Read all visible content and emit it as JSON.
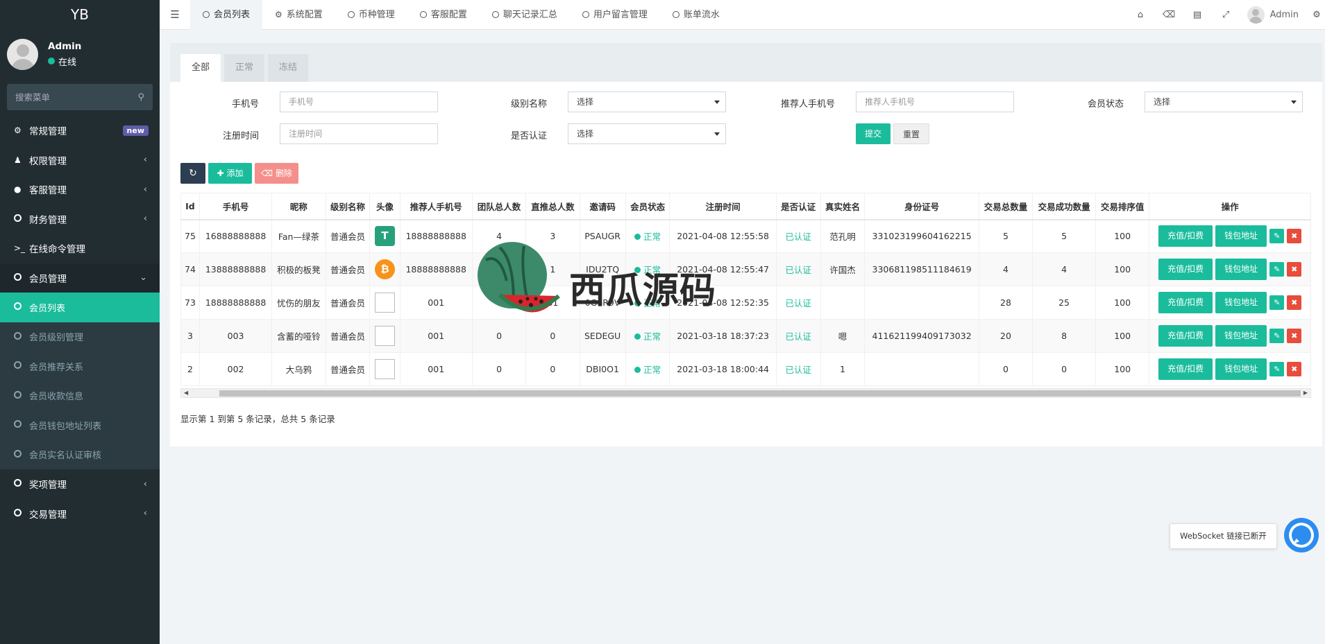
{
  "sidebar": {
    "logo": "YB",
    "user": {
      "name": "Admin",
      "status": "在线"
    },
    "search_placeholder": "搜索菜单",
    "menu": [
      {
        "label": "常规管理",
        "icon": "cogs-icon",
        "badge": "new"
      },
      {
        "label": "权限管理",
        "icon": "users-icon"
      },
      {
        "label": "客服管理",
        "icon": "comment-icon"
      },
      {
        "label": "财务管理",
        "icon": "circle-icon"
      },
      {
        "label": "在线命令管理",
        "icon": "terminal-icon"
      },
      {
        "label": "会员管理",
        "icon": "circle-icon"
      }
    ],
    "submenu": [
      {
        "label": "会员列表"
      },
      {
        "label": "会员级别管理"
      },
      {
        "label": "会员推荐关系"
      },
      {
        "label": "会员收款信息"
      },
      {
        "label": "会员钱包地址列表"
      },
      {
        "label": "会员实名认证审核"
      }
    ],
    "menu_after": [
      {
        "label": "奖项管理"
      },
      {
        "label": "交易管理"
      }
    ]
  },
  "topbar": {
    "tabs": [
      "会员列表",
      "系统配置",
      "币种管理",
      "客服配置",
      "聊天记录汇总",
      "用户留言管理",
      "账单流水"
    ],
    "user_name": "Admin"
  },
  "status_tabs": [
    "全部",
    "正常",
    "冻结"
  ],
  "filters": {
    "phone_label": "手机号",
    "phone_placeholder": "手机号",
    "level_label": "级别名称",
    "level_value": "选择",
    "ref_label": "推荐人手机号",
    "ref_placeholder": "推荐人手机号",
    "status_label": "会员状态",
    "status_value": "选择",
    "regtime_label": "注册时间",
    "regtime_placeholder": "注册时间",
    "verified_label": "是否认证",
    "verified_value": "选择",
    "submit": "提交",
    "reset": "重置"
  },
  "toolbar": {
    "add": "添加",
    "delete": "删除"
  },
  "table": {
    "columns": [
      "Id",
      "手机号",
      "昵称",
      "级别名称",
      "头像",
      "推荐人手机号",
      "团队总人数",
      "直推总人数",
      "邀请码",
      "会员状态",
      "注册时间",
      "是否认证",
      "真实姓名",
      "身份证号",
      "交易总数量",
      "交易成功数量",
      "交易排序值",
      "操作"
    ],
    "rows": [
      {
        "id": "75",
        "phone": "16888888888",
        "nick": "Fan—绿茶",
        "level": "普通会员",
        "avatar": "usdt",
        "ref": "18888888888",
        "team": "4",
        "direct": "3",
        "code": "PSAUGR",
        "status": "正常",
        "reg": "2021-04-08 12:55:58",
        "verified": "已认证",
        "name": "范孔明",
        "idno": "331023199604162215",
        "total": "5",
        "success": "5",
        "sort": "100"
      },
      {
        "id": "74",
        "phone": "13888888888",
        "nick": "积极的板凳",
        "level": "普通会员",
        "avatar": "btc",
        "ref": "18888888888",
        "team": "",
        "direct": "1",
        "code": "IDU2TQ",
        "status": "正常",
        "reg": "2021-04-08 12:55:47",
        "verified": "已认证",
        "name": "许国杰",
        "idno": "330681198511184619",
        "total": "4",
        "success": "4",
        "sort": "100"
      },
      {
        "id": "73",
        "phone": "18888888888",
        "nick": "忧伤的朋友",
        "level": "普通会员",
        "avatar": "broken",
        "ref": "001",
        "team": "",
        "direct": "61",
        "code": "0G6R9V",
        "status": "正常",
        "reg": "2021-04-08 12:52:35",
        "verified": "已认证",
        "name": "",
        "idno": "",
        "total": "28",
        "success": "25",
        "sort": "100"
      },
      {
        "id": "3",
        "phone": "003",
        "nick": "含蓄的哑铃",
        "level": "普通会员",
        "avatar": "broken",
        "ref": "001",
        "team": "0",
        "direct": "0",
        "code": "SEDEGU",
        "status": "正常",
        "reg": "2021-03-18 18:37:23",
        "verified": "已认证",
        "name": "嗯",
        "idno": "411621199409173032",
        "total": "20",
        "success": "8",
        "sort": "100"
      },
      {
        "id": "2",
        "phone": "002",
        "nick": "大乌鸦",
        "level": "普通会员",
        "avatar": "broken",
        "ref": "001",
        "team": "0",
        "direct": "0",
        "code": "DBI0O1",
        "status": "正常",
        "reg": "2021-03-18 18:00:44",
        "verified": "已认证",
        "name": "1",
        "idno": "",
        "total": "0",
        "success": "0",
        "sort": "100"
      }
    ],
    "op_recharge": "充值/扣费",
    "op_wallet": "钱包地址"
  },
  "footer_info": "显示第 1 到第 5 条记录，总共 5 条记录",
  "watermark": "西瓜源码",
  "websocket_tip": "WebSocket 链接已断开",
  "colors": {
    "accent": "#1abc9c",
    "sidebar": "#222d32",
    "danger": "#e74c3c"
  }
}
